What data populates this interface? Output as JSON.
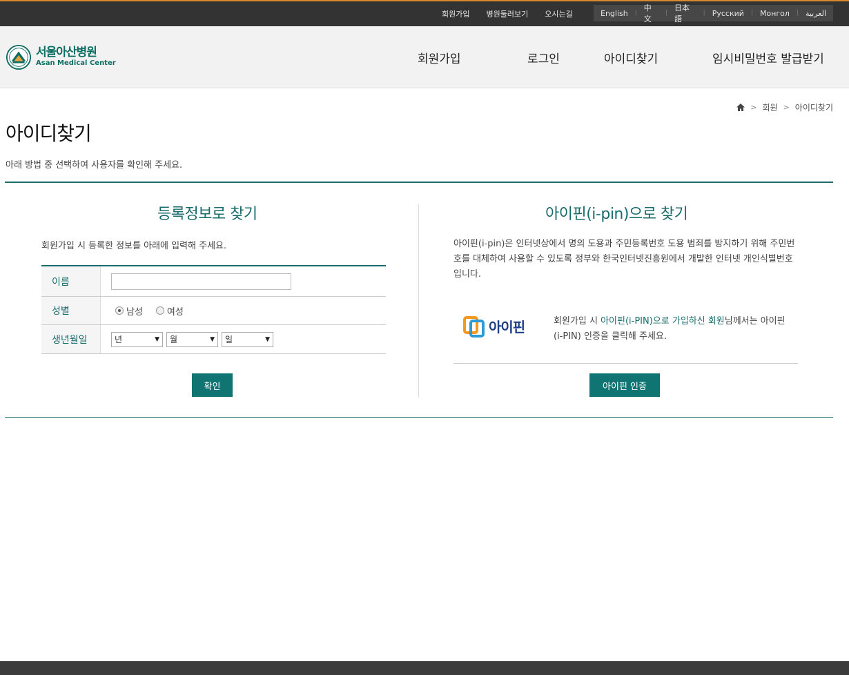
{
  "util_links": [
    "회원가입",
    "병원둘러보기",
    "오시는길"
  ],
  "languages": [
    "English",
    "中文",
    "日本語",
    "Русский",
    "Монгол",
    "العربية"
  ],
  "logo": {
    "korean": "서울아산병원",
    "english": "Asan Medical Center"
  },
  "gnb": [
    "회원가입",
    "로그인",
    "아이디찾기",
    "임시비밀번호 발급받기"
  ],
  "breadcrumb": [
    "회원",
    "아이디찾기"
  ],
  "page": {
    "title": "아이디찾기",
    "description": "아래 방법 중 선택하여 사용자를 확인해 주세요."
  },
  "register_find": {
    "title": "등록정보로 찾기",
    "description": "회원가입 시 등록한 정보를 아래에 입력해 주세요.",
    "name_label": "이름",
    "name_value": "",
    "gender_label": "성별",
    "gender_options": [
      "남성",
      "여성"
    ],
    "gender_selected": "남성",
    "birth_label": "생년월일",
    "year": "년",
    "month": "월",
    "day": "일",
    "confirm_label": "확인"
  },
  "ipin_find": {
    "title": "아이핀(i-pin)으로 찾기",
    "description": "아이핀(i-pin)은 인터넷상에서 명의 도용과 주민등록번호 도용 범죄를 방지하기 위해 주민번호를 대체하여 사용할 수 있도록 정부와 한국인터넷진흥원에서 개발한 인터넷 개인식별번호 입니다.",
    "logo_text": "아이핀",
    "notice_before": "회원가입 시 ",
    "notice_highlight": "아이핀(i-PIN)으로 가입하신 회원",
    "notice_after": "님께서는 아이핀(i-PIN) 인증을 클릭해 주세요.",
    "button_label": "아이핀 인증"
  },
  "colors": {
    "accent": "#1a6b6b",
    "button": "#0f7472",
    "topbar": "#333333"
  }
}
